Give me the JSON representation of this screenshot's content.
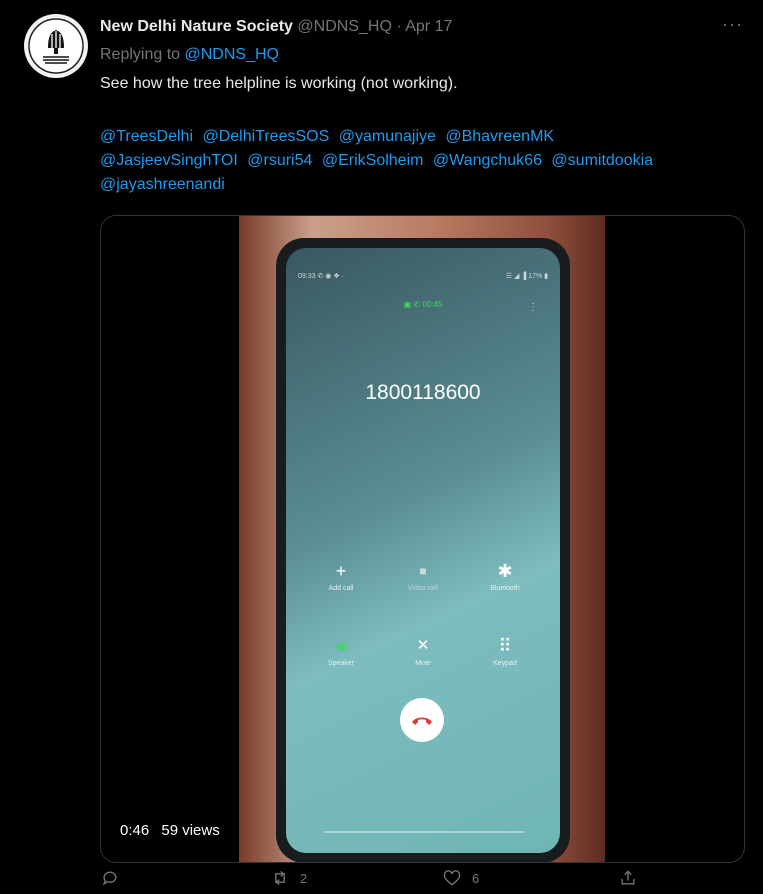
{
  "tweet": {
    "author_name": "New Delhi Nature Society",
    "handle": "@NDNS_HQ",
    "separator": "·",
    "date": "Apr 17",
    "more": "···",
    "replying_to_label": "Replying to",
    "replying_to_handle": "@NDNS_HQ",
    "text": "See how the tree helpline is working (not working).",
    "mentions": [
      "@TreesDelhi",
      "@DelhiTreesSOS",
      "@yamunajiye",
      "@BhavreenMK",
      "@JasjeevSinghTOI",
      "@rsuri54",
      "@ErikSolheim",
      "@Wangchuk66",
      "@sumitdookia",
      "@jayashreenandi"
    ]
  },
  "video": {
    "time": "0:46",
    "views": "59 views",
    "phone_screen": {
      "status_left": "09:33 ✆ ◉ ❖ ·",
      "status_right": "☰ ◢ ▐ 17% ▮",
      "call_timer": "▣ ✆ 00:45",
      "menu": "⋮",
      "number": "1800118600",
      "controls": [
        {
          "icon": "+",
          "label": "Add call"
        },
        {
          "icon": "■",
          "label": "Video call"
        },
        {
          "icon": "✱",
          "label": "Bluetooth"
        },
        {
          "icon": "◀)",
          "label": "Speaker"
        },
        {
          "icon": "✕",
          "label": "Mute"
        },
        {
          "icon": "⠿",
          "label": "Keypad"
        }
      ]
    }
  },
  "actions": {
    "reply_count": "",
    "retweet_count": "2",
    "like_count": "6"
  },
  "colors": {
    "background": "#000000",
    "accent": "#1d9bf0",
    "muted": "#71767b",
    "call_green": "#49d36a",
    "end_call_red": "#e0373a"
  }
}
